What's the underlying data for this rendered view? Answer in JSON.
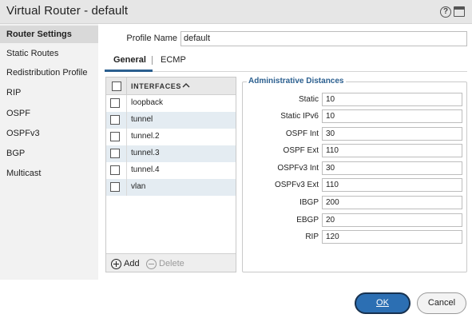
{
  "window": {
    "title": "Virtual Router - default",
    "help_icon": "?"
  },
  "sidebar": {
    "items": [
      {
        "label": "Router Settings",
        "active": true
      },
      {
        "label": "Static Routes"
      },
      {
        "label": "Redistribution Profile"
      },
      {
        "label": "RIP"
      },
      {
        "label": "OSPF"
      },
      {
        "label": "OSPFv3"
      },
      {
        "label": "BGP"
      },
      {
        "label": "Multicast"
      }
    ]
  },
  "profile": {
    "label": "Profile Name",
    "value": "default"
  },
  "tabs": [
    {
      "label": "General",
      "active": true
    },
    {
      "label": "ECMP"
    }
  ],
  "interfaces": {
    "header": "INTERFACES",
    "rows": [
      "loopback",
      "tunnel",
      "tunnel.2",
      "tunnel.3",
      "tunnel.4",
      "vlan"
    ],
    "add_label": "Add",
    "delete_label": "Delete"
  },
  "admin_distances": {
    "title": "Administrative Distances",
    "fields": [
      {
        "label": "Static",
        "value": "10"
      },
      {
        "label": "Static IPv6",
        "value": "10"
      },
      {
        "label": "OSPF Int",
        "value": "30"
      },
      {
        "label": "OSPF Ext",
        "value": "110"
      },
      {
        "label": "OSPFv3 Int",
        "value": "30"
      },
      {
        "label": "OSPFv3 Ext",
        "value": "110"
      },
      {
        "label": "IBGP",
        "value": "200"
      },
      {
        "label": "EBGP",
        "value": "20"
      },
      {
        "label": "RIP",
        "value": "120"
      }
    ]
  },
  "footer": {
    "ok_label": "OK",
    "cancel_label": "Cancel"
  },
  "colors": {
    "accent": "#2b5f8f",
    "ok_button": "#2c6fb3",
    "alt_row": "#e4ecf2"
  }
}
